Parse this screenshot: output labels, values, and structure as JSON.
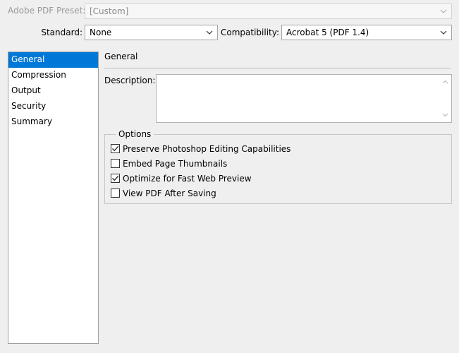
{
  "preset": {
    "label": "Adobe PDF Preset:",
    "value": "[Custom]"
  },
  "standard": {
    "label": "Standard:",
    "value": "None"
  },
  "compatibility": {
    "label": "Compatibility:",
    "value": "Acrobat 5 (PDF 1.4)"
  },
  "sidebar": {
    "items": [
      {
        "label": "General",
        "selected": true
      },
      {
        "label": "Compression"
      },
      {
        "label": "Output"
      },
      {
        "label": "Security"
      },
      {
        "label": "Summary"
      }
    ]
  },
  "panel": {
    "title": "General",
    "description_label": "Description:",
    "description_value": "",
    "options_legend": "Options",
    "options": [
      {
        "label": "Preserve Photoshop Editing Capabilities",
        "checked": true
      },
      {
        "label": "Embed Page Thumbnails",
        "checked": false
      },
      {
        "label": "Optimize for Fast Web Preview",
        "checked": true
      },
      {
        "label": "View PDF After Saving",
        "checked": false
      }
    ]
  },
  "colors": {
    "selection": "#0078d7",
    "background": "#efefef"
  }
}
